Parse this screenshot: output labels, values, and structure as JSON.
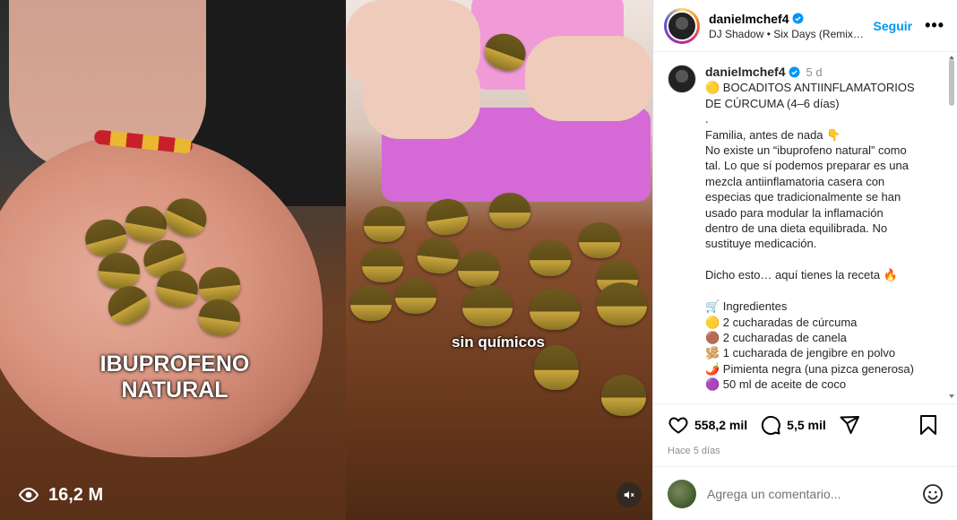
{
  "left_panel": {
    "caption": "IBUPROFENO NATURAL",
    "views": "16,2 M"
  },
  "mid_panel": {
    "caption": "sin químicos"
  },
  "header": {
    "username": "danielmchef4",
    "song": "DJ Shadow • Six Days (Remix) [fe...",
    "follow_label": "Seguir",
    "more_label": "•••"
  },
  "caption": {
    "username": "danielmchef4",
    "time": "5 d",
    "lines": [
      "🟡 BOCADITOS ANTIINFLAMATORIOS",
      "DE CÚRCUMA (4–6 días)",
      ".",
      "Familia, antes de nada 👇",
      "No existe un “ibuprofeno natural” como",
      "tal. Lo que sí podemos preparar es una",
      "mezcla antiinflamatoria casera con",
      "especias que tradicionalmente se han",
      "usado para modular la inflamación",
      "dentro de una dieta equilibrada. No",
      "sustituye medicación.",
      " ",
      "Dicho esto… aquí tienes la receta 🔥",
      " ",
      "🛒 Ingredientes",
      "🟡 2 cucharadas de cúrcuma",
      "🟤 2 cucharadas de canela",
      "🫚 1 cucharada de jengibre en polvo",
      "🌶️ Pimienta negra (una pizca generosa)",
      "🟣 50 ml de aceite de coco"
    ]
  },
  "actions": {
    "likes": "558,2 mil",
    "comments": "5,5 mil",
    "posted": "Hace 5 días"
  },
  "comment_box": {
    "placeholder": "Agrega un comentario..."
  },
  "colors": {
    "accent": "#0095f6",
    "verified": "#0095f6"
  }
}
